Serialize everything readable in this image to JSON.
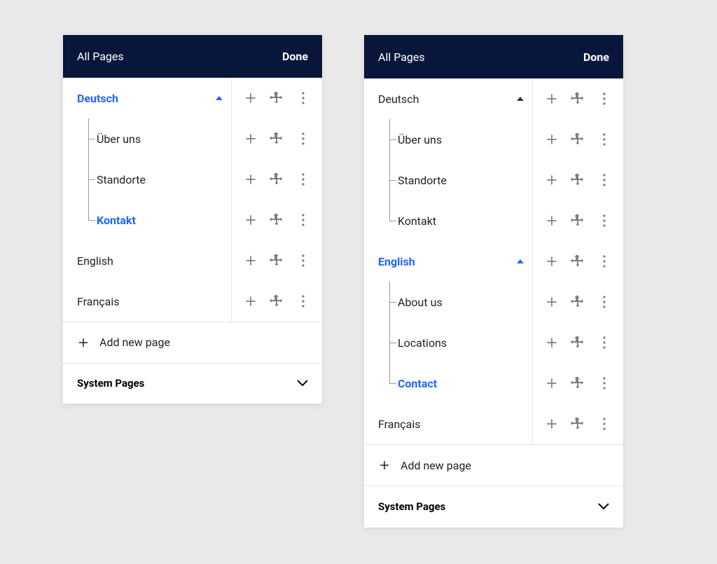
{
  "colors": {
    "header_bg": "#08163B",
    "accent": "#1F66FF",
    "icon": "#7A7A7A"
  },
  "panels": [
    {
      "header": {
        "title": "All Pages",
        "done": "Done"
      },
      "tree": [
        {
          "label": "Deutsch",
          "active": true,
          "expanded": true,
          "children": [
            {
              "label": "Über uns",
              "active": false
            },
            {
              "label": "Standorte",
              "active": false
            },
            {
              "label": "Kontakt",
              "active": true
            }
          ]
        },
        {
          "label": "English",
          "active": false,
          "expanded": false,
          "children": []
        },
        {
          "label": "Français",
          "active": false,
          "expanded": false,
          "children": []
        }
      ],
      "add_label": "Add new page",
      "system_label": "System Pages"
    },
    {
      "header": {
        "title": "All Pages",
        "done": "Done"
      },
      "tree": [
        {
          "label": "Deutsch",
          "active": false,
          "expanded": true,
          "children": [
            {
              "label": "Über uns",
              "active": false
            },
            {
              "label": "Standorte",
              "active": false
            },
            {
              "label": "Kontakt",
              "active": false
            }
          ]
        },
        {
          "label": "English",
          "active": true,
          "expanded": true,
          "children": [
            {
              "label": "About us",
              "active": false
            },
            {
              "label": "Locations",
              "active": false
            },
            {
              "label": "Contact",
              "active": true
            }
          ]
        },
        {
          "label": "Français",
          "active": false,
          "expanded": false,
          "children": []
        }
      ],
      "add_label": "Add new page",
      "system_label": "System Pages"
    }
  ]
}
